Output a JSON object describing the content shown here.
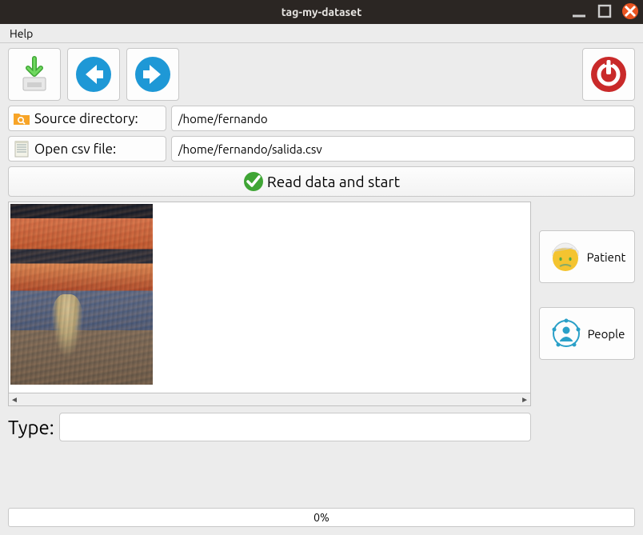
{
  "window": {
    "title": "tag-my-dataset"
  },
  "menubar": {
    "help": "Help"
  },
  "paths": {
    "source_label": "Source directory:",
    "source_value": "/home/fernando",
    "csv_label": "Open csv file:",
    "csv_value": "/home/fernando/salida.csv"
  },
  "actions": {
    "read_start": "Read data and start"
  },
  "tags": {
    "patient": "Patient",
    "people": "People"
  },
  "type": {
    "label": "Type:",
    "value": ""
  },
  "progress": {
    "text": "0%"
  }
}
